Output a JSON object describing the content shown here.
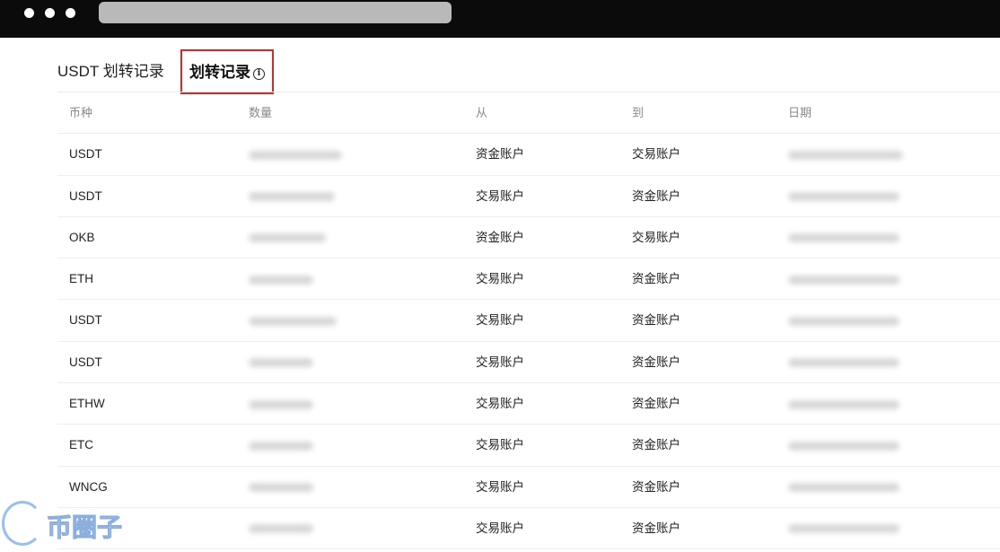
{
  "tabs": {
    "tab1_label": "USDT 划转记录",
    "tab2_label": "划转记录"
  },
  "table": {
    "columns": [
      "币种",
      "数量",
      "从",
      "到",
      "日期"
    ],
    "rows": [
      {
        "coin": "USDT",
        "from": "资金账户",
        "to": "交易账户"
      },
      {
        "coin": "USDT",
        "from": "交易账户",
        "to": "资金账户"
      },
      {
        "coin": "OKB",
        "from": "资金账户",
        "to": "交易账户"
      },
      {
        "coin": "ETH",
        "from": "交易账户",
        "to": "资金账户"
      },
      {
        "coin": "USDT",
        "from": "交易账户",
        "to": "资金账户"
      },
      {
        "coin": "USDT",
        "from": "交易账户",
        "to": "资金账户"
      },
      {
        "coin": "ETHW",
        "from": "交易账户",
        "to": "资金账户"
      },
      {
        "coin": "ETC",
        "from": "交易账户",
        "to": "资金账户"
      },
      {
        "coin": "WNCG",
        "from": "交易账户",
        "to": "资金账户"
      },
      {
        "coin": "",
        "from": "交易账户",
        "to": "资金账户"
      }
    ]
  },
  "watermark": {
    "text": "币圈子"
  },
  "colors": {
    "titlebar": "#0b0b0b",
    "highlight_border": "#e02424",
    "header_text": "#8a8a8a"
  }
}
